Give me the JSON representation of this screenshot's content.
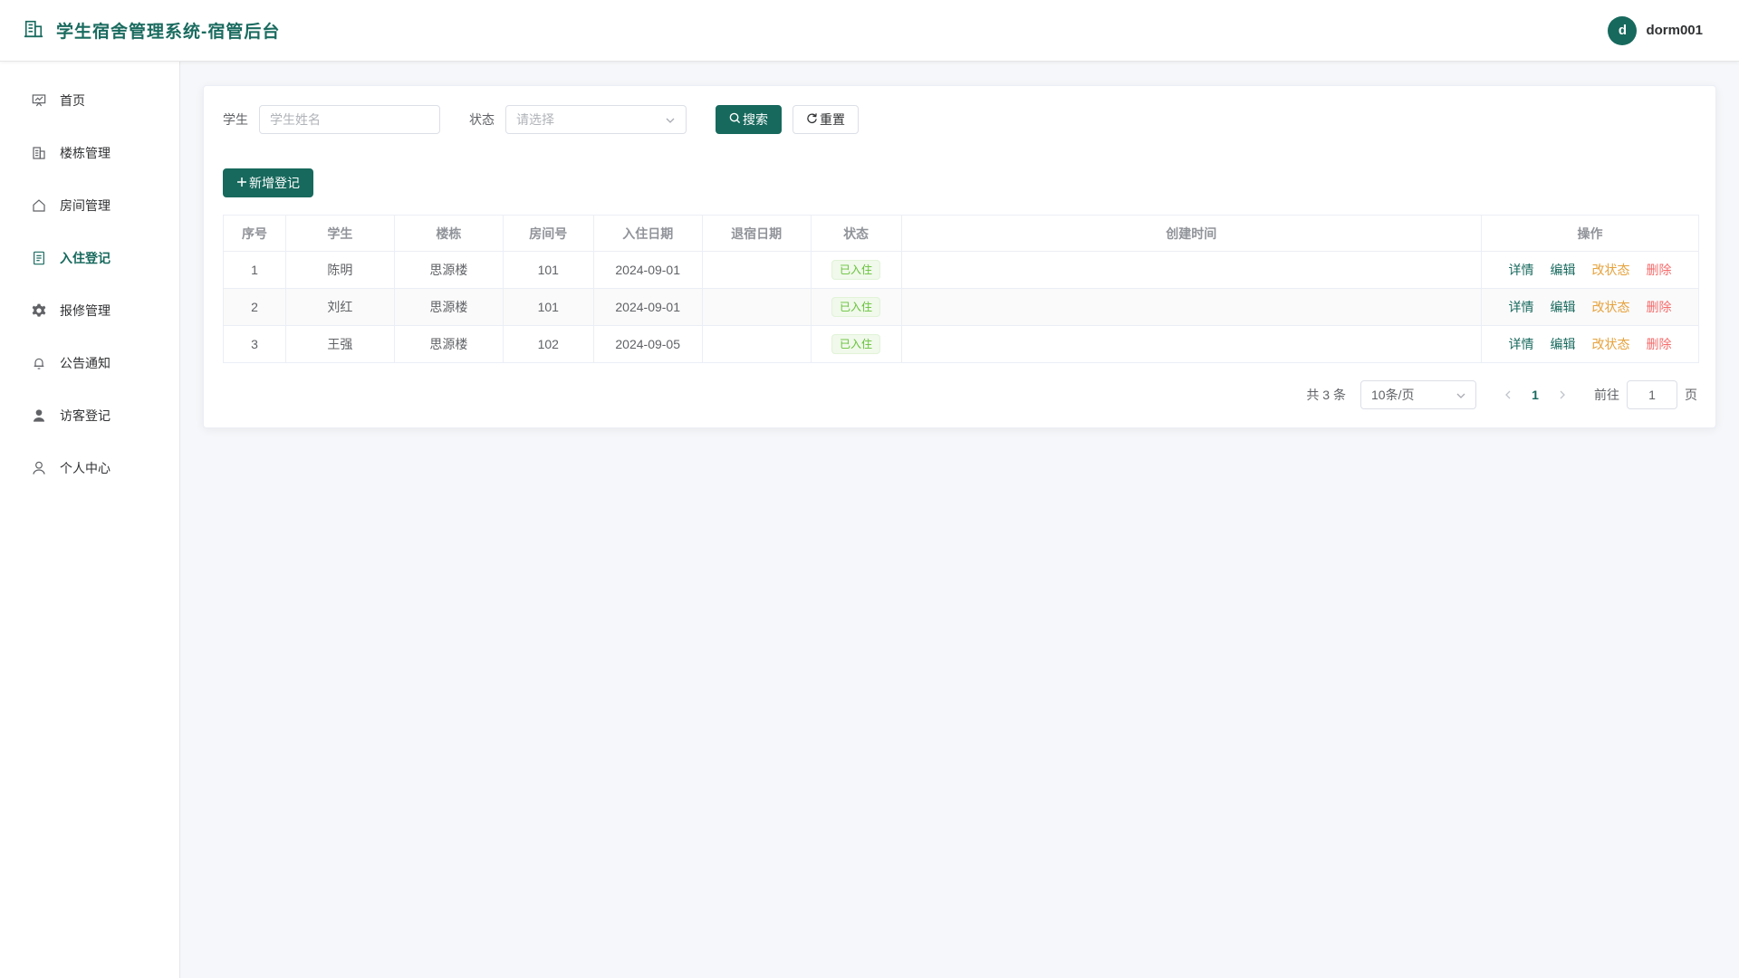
{
  "header": {
    "title": "学生宿舍管理系统-宿管后台",
    "avatar_letter": "d",
    "username": "dorm001"
  },
  "sidebar": {
    "items": [
      {
        "label": "首页",
        "icon": "dashboard-icon"
      },
      {
        "label": "楼栋管理",
        "icon": "building-icon"
      },
      {
        "label": "房间管理",
        "icon": "house-icon"
      },
      {
        "label": "入住登记",
        "icon": "document-icon",
        "active": true
      },
      {
        "label": "报修管理",
        "icon": "gear-icon"
      },
      {
        "label": "公告通知",
        "icon": "bell-icon"
      },
      {
        "label": "访客登记",
        "icon": "user-filled-icon"
      },
      {
        "label": "个人中心",
        "icon": "user-icon"
      }
    ]
  },
  "filters": {
    "student_label": "学生",
    "student_placeholder": "学生姓名",
    "status_label": "状态",
    "status_placeholder": "请选择",
    "search_label": "搜索",
    "reset_label": "重置"
  },
  "add_button": "新增登记",
  "table": {
    "headers": [
      "序号",
      "学生",
      "楼栋",
      "房间号",
      "入住日期",
      "退宿日期",
      "状态",
      "创建时间",
      "操作"
    ],
    "rows": [
      {
        "idx": "1",
        "student": "陈明",
        "building": "思源楼",
        "room": "101",
        "checkin": "2024-09-01",
        "checkout": "",
        "status": "已入住",
        "created": ""
      },
      {
        "idx": "2",
        "student": "刘红",
        "building": "思源楼",
        "room": "101",
        "checkin": "2024-09-01",
        "checkout": "",
        "status": "已入住",
        "created": ""
      },
      {
        "idx": "3",
        "student": "王强",
        "building": "思源楼",
        "room": "102",
        "checkin": "2024-09-05",
        "checkout": "",
        "status": "已入住",
        "created": ""
      }
    ],
    "actions": {
      "detail": "详情",
      "edit": "编辑",
      "change_status": "改状态",
      "delete": "删除"
    }
  },
  "pagination": {
    "total_text": "共 3 条",
    "page_size": "10条/页",
    "current_page": "1",
    "goto_label": "前往",
    "goto_value": "1",
    "page_suffix": "页"
  }
}
